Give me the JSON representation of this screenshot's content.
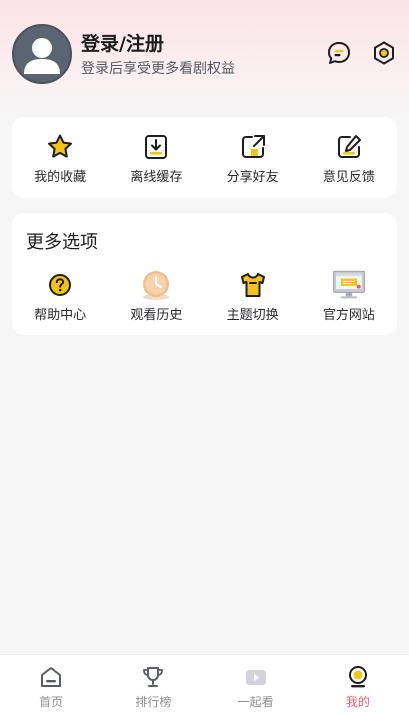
{
  "profile": {
    "title": "登录/注册",
    "subtitle": "登录后享受更多看剧权益"
  },
  "header_icons": [
    {
      "icon": "message-icon"
    },
    {
      "icon": "settings-icon"
    }
  ],
  "quick_actions": [
    {
      "label": "我的收藏",
      "icon": "star-icon"
    },
    {
      "label": "离线缓存",
      "icon": "download-icon"
    },
    {
      "label": "分享好友",
      "icon": "share-icon"
    },
    {
      "label": "意见反馈",
      "icon": "feedback-icon"
    }
  ],
  "more_options": {
    "title": "更多选项",
    "items": [
      {
        "label": "帮助中心",
        "icon": "help-icon"
      },
      {
        "label": "观看历史",
        "icon": "history-clock-icon"
      },
      {
        "label": "主题切换",
        "icon": "theme-shirt-icon"
      },
      {
        "label": "官方网站",
        "icon": "website-monitor-icon"
      }
    ]
  },
  "tabbar": {
    "items": [
      {
        "label": "首页",
        "icon": "home-icon",
        "active": false
      },
      {
        "label": "排行榜",
        "icon": "trophy-icon",
        "active": false
      },
      {
        "label": "一起看",
        "icon": "video-icon",
        "active": false
      },
      {
        "label": "我的",
        "icon": "profile-icon",
        "active": true
      }
    ]
  },
  "colors": {
    "accent": "#f15d6e",
    "icon_yellow": "#f5c418",
    "header_tint": "#fbe3e7"
  }
}
